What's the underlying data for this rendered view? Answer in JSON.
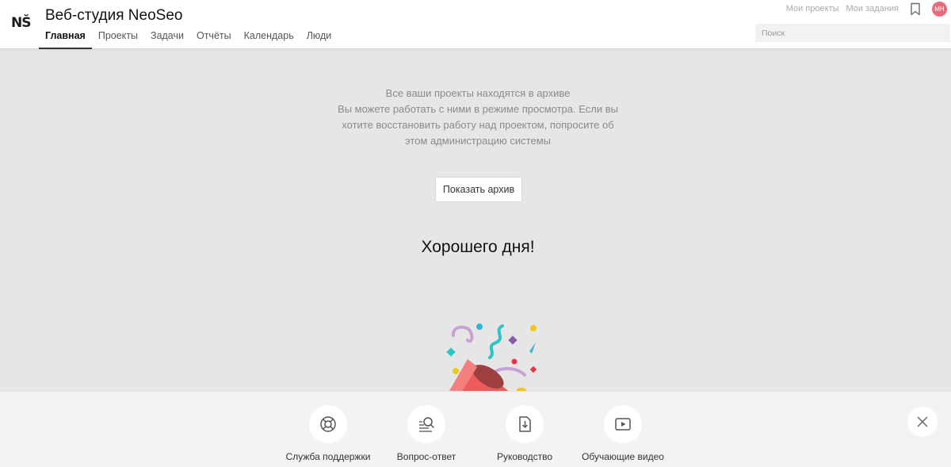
{
  "header": {
    "logo_text": "NŠ",
    "title": "Веб-студия NeoSeo",
    "tabs": [
      {
        "label": "Главная",
        "active": true
      },
      {
        "label": "Проекты",
        "active": false
      },
      {
        "label": "Задачи",
        "active": false
      },
      {
        "label": "Отчёты",
        "active": false
      },
      {
        "label": "Календарь",
        "active": false
      },
      {
        "label": "Люди",
        "active": false
      }
    ],
    "top_links": {
      "projects": "Мои проекты",
      "tasks": "Мои задания"
    },
    "avatar_initials": "МН",
    "search_placeholder": "Поиск",
    "bookmark_icon": "bookmark-icon"
  },
  "main": {
    "archive_message": [
      "Все ваши проекты находятся в архиве",
      "Вы можете работать с ними в режиме просмотра. Если вы",
      "хотите восстановить работу над проектом, попросите об",
      "этом администрацию системы"
    ],
    "show_archive_label": "Показать архив",
    "greeting": "Хорошего дня!",
    "illustration_icon": "party-popper-icon"
  },
  "help_bar": {
    "items": [
      {
        "label": "Служба поддержки",
        "icon": "lifebuoy-icon"
      },
      {
        "label": "Вопрос-ответ",
        "icon": "faq-search-icon"
      },
      {
        "label": "Руководство",
        "icon": "guide-download-icon"
      },
      {
        "label": "Обучающие видео",
        "icon": "video-play-icon"
      }
    ],
    "close_icon": "close-icon"
  },
  "colors": {
    "background": "#e6e6e6",
    "header": "#ffffff",
    "avatar": "#e86b7a",
    "help_bar": "#f3f3f3"
  }
}
